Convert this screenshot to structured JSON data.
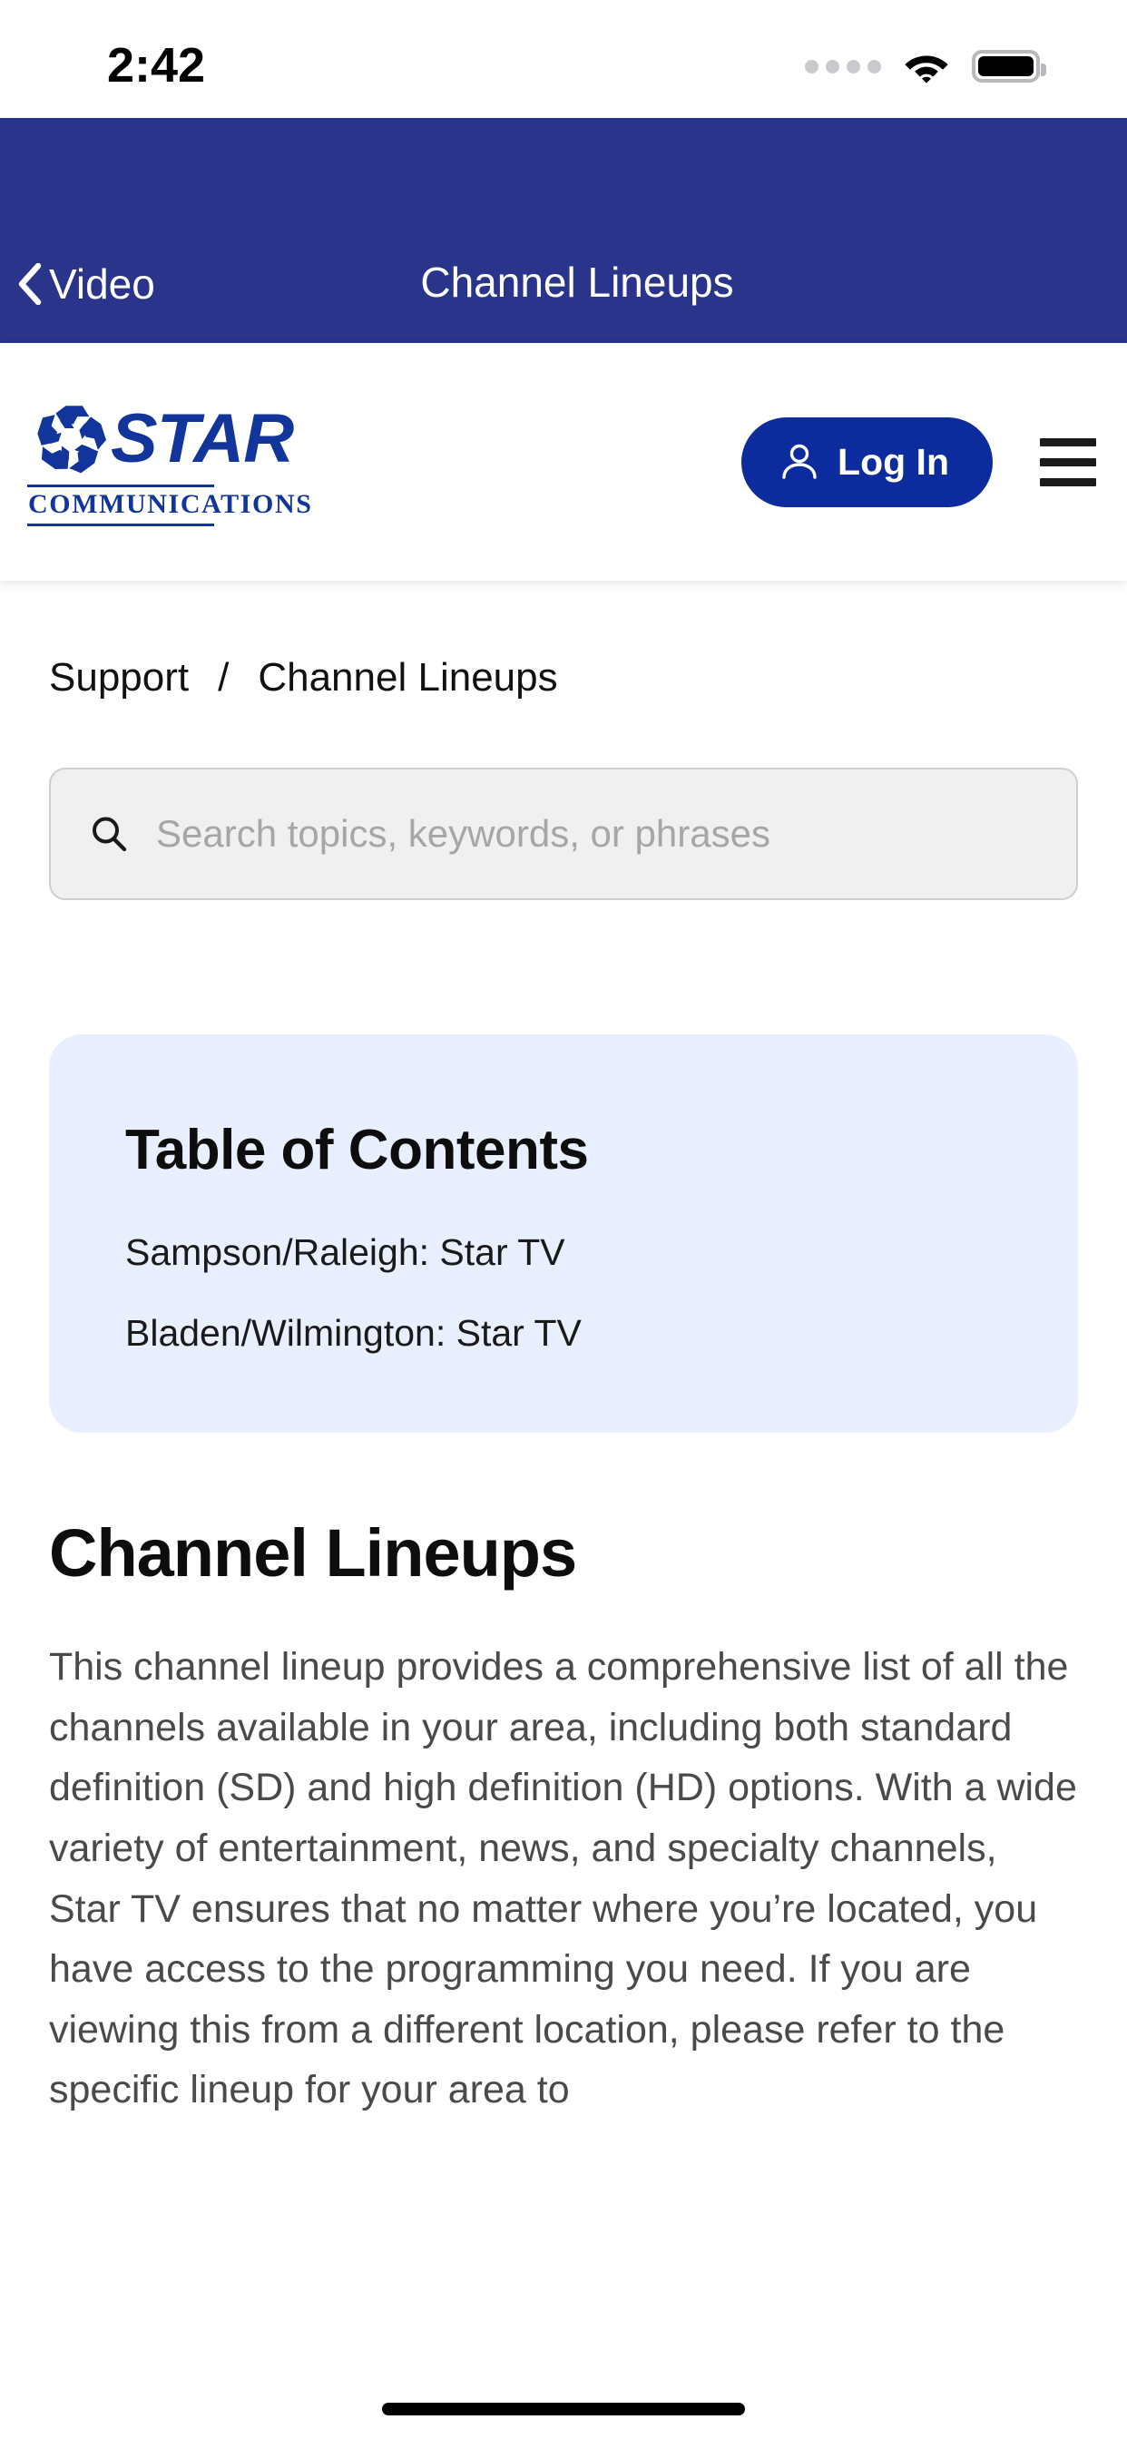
{
  "status_bar": {
    "time": "2:42",
    "cellular_icon": "cellular-dots-icon",
    "wifi_icon": "wifi-icon",
    "battery_icon": "battery-full-icon"
  },
  "app_nav": {
    "back_icon": "chevron-left-icon",
    "back_label": "Video",
    "title": "Channel Lineups"
  },
  "site_header": {
    "logo": {
      "mark_icon": "star-pinwheel-icon",
      "wordmark": "STAR",
      "subtext": "COMMUNICATIONS"
    },
    "login": {
      "icon": "user-icon",
      "label": "Log In"
    },
    "menu_icon": "hamburger-menu-icon"
  },
  "breadcrumb": {
    "parent": "Support",
    "separator": "/",
    "current": "Channel Lineups"
  },
  "search": {
    "icon": "search-icon",
    "placeholder": "Search topics, keywords, or phrases",
    "value": ""
  },
  "table_of_contents": {
    "title": "Table of Contents",
    "items": [
      "Sampson/Raleigh: Star TV",
      "Bladen/Wilmington: Star TV"
    ]
  },
  "main": {
    "title": "Channel Lineups",
    "body": "This channel lineup provides a comprehensive list of all the channels available in your area, including both standard definition (SD) and high definition (HD) options. With a wide variety of entertainment, news, and specialty channels, Star TV ensures that no matter where you’re located, you have access to the programming you need. If you are viewing this from a different location, please refer to the specific lineup for your area to"
  },
  "colors": {
    "nav_blue": "#29348a",
    "brand_blue": "#12359c",
    "login_blue": "#0c2b9c",
    "toc_card_blue": "#e9efff",
    "search_bg": "#f0f0f0",
    "body_text": "#4a4a4a"
  },
  "home_indicator": "home-indicator"
}
